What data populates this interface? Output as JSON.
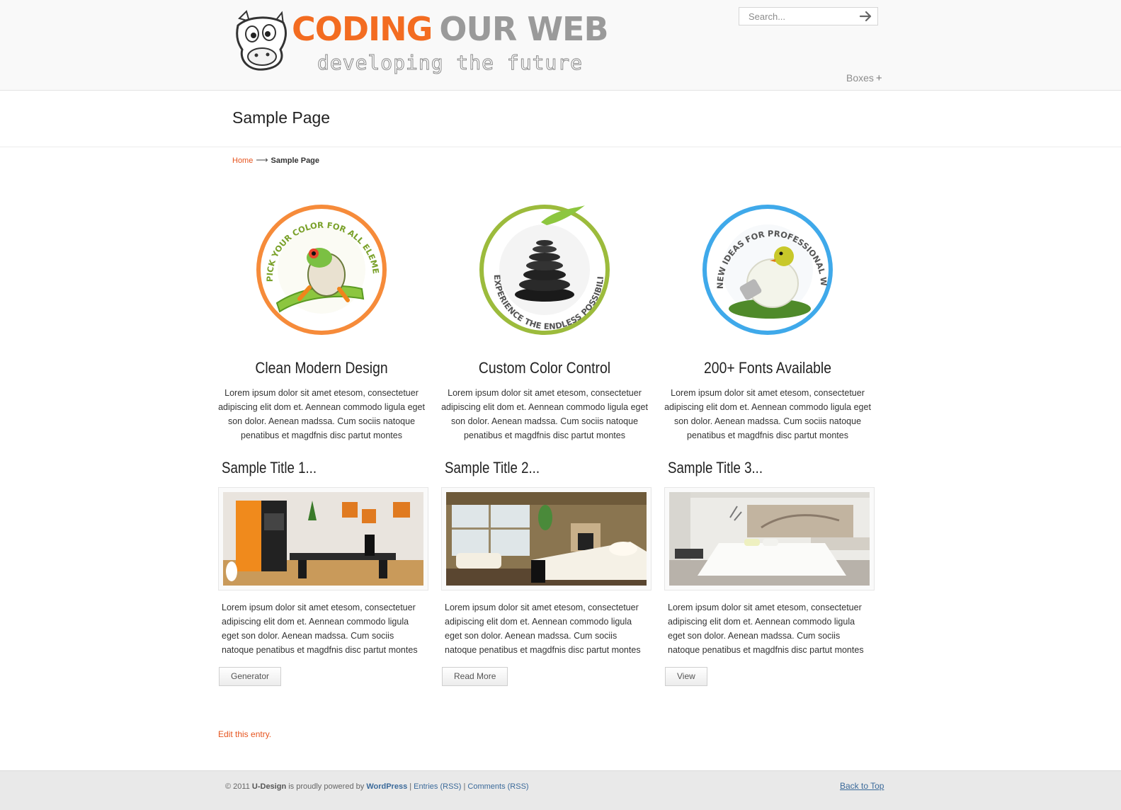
{
  "header": {
    "logo_word1": "CODING",
    "logo_word2": "OUR WEB",
    "tagline": "developing the future",
    "search_placeholder": "Search...",
    "nav_boxes_label": "Boxes",
    "nav_plus": "+"
  },
  "page": {
    "title": "Sample Page",
    "breadcrumb_home": "Home",
    "breadcrumb_arrow": "⟶",
    "breadcrumb_current": "Sample Page"
  },
  "features": [
    {
      "title": "Clean Modern Design",
      "badge_text": "PICK YOUR COLOR FOR ALL ELEMENTS",
      "text": "Lorem ipsum dolor sit amet etesom, consectetuer adipiscing elit dom et. Aennean commodo ligula eget son dolor. Aenean madssa. Cum sociis natoque penatibus et magdfnis disc partut montes"
    },
    {
      "title": "Custom Color Control",
      "badge_text": "EXPERIENCE THE ENDLESS POSSIBILITIES",
      "text": "Lorem ipsum dolor sit amet etesom, consectetuer adipiscing elit dom et. Aennean commodo ligula eget son dolor. Aenean madssa. Cum sociis natoque penatibus et magdfnis disc partut montes"
    },
    {
      "title": "200+ Fonts Available",
      "badge_text": "NEW IDEAS FOR PROFESSIONAL WEBSITE",
      "text": "Lorem ipsum dolor sit amet etesom, consectetuer adipiscing elit dom et. Aennean commodo ligula eget son dolor. Aenean madssa. Cum sociis natoque penatibus et magdfnis disc partut montes"
    }
  ],
  "samples": [
    {
      "title": "Sample Title 1...",
      "text": "Lorem ipsum dolor sit amet etesom, consectetuer adipiscing elit dom et. Aennean commodo ligula eget son dolor. Aenean madssa. Cum sociis natoque penatibus et magdfnis disc partut montes",
      "button": "Generator"
    },
    {
      "title": "Sample Title 2...",
      "text": "Lorem ipsum dolor sit amet etesom, consectetuer adipiscing elit dom et. Aennean commodo ligula eget son dolor. Aenean madssa. Cum sociis natoque penatibus et magdfnis disc partut montes",
      "button": "Read More"
    },
    {
      "title": "Sample Title 3...",
      "text": "Lorem ipsum dolor sit amet etesom, consectetuer adipiscing elit dom et. Aennean commodo ligula eget son dolor. Aenean madssa. Cum sociis natoque penatibus et magdfnis disc partut montes",
      "button": "View"
    }
  ],
  "edit_link": "Edit this entry.",
  "footer": {
    "copyright": "© 2011",
    "udesign": "U-Design",
    "powered": "is proudly powered by",
    "wordpress": "WordPress",
    "sep": "|",
    "entries": "Entries (RSS)",
    "comments": "Comments (RSS)",
    "back_to_top": "Back to Top"
  },
  "colors": {
    "accent_orange": "#f36c21",
    "badge_orange": "#f68b3a",
    "badge_green": "#9cbb3c",
    "badge_blue": "#3fa9ea",
    "link_blue": "#3b6a9a"
  }
}
